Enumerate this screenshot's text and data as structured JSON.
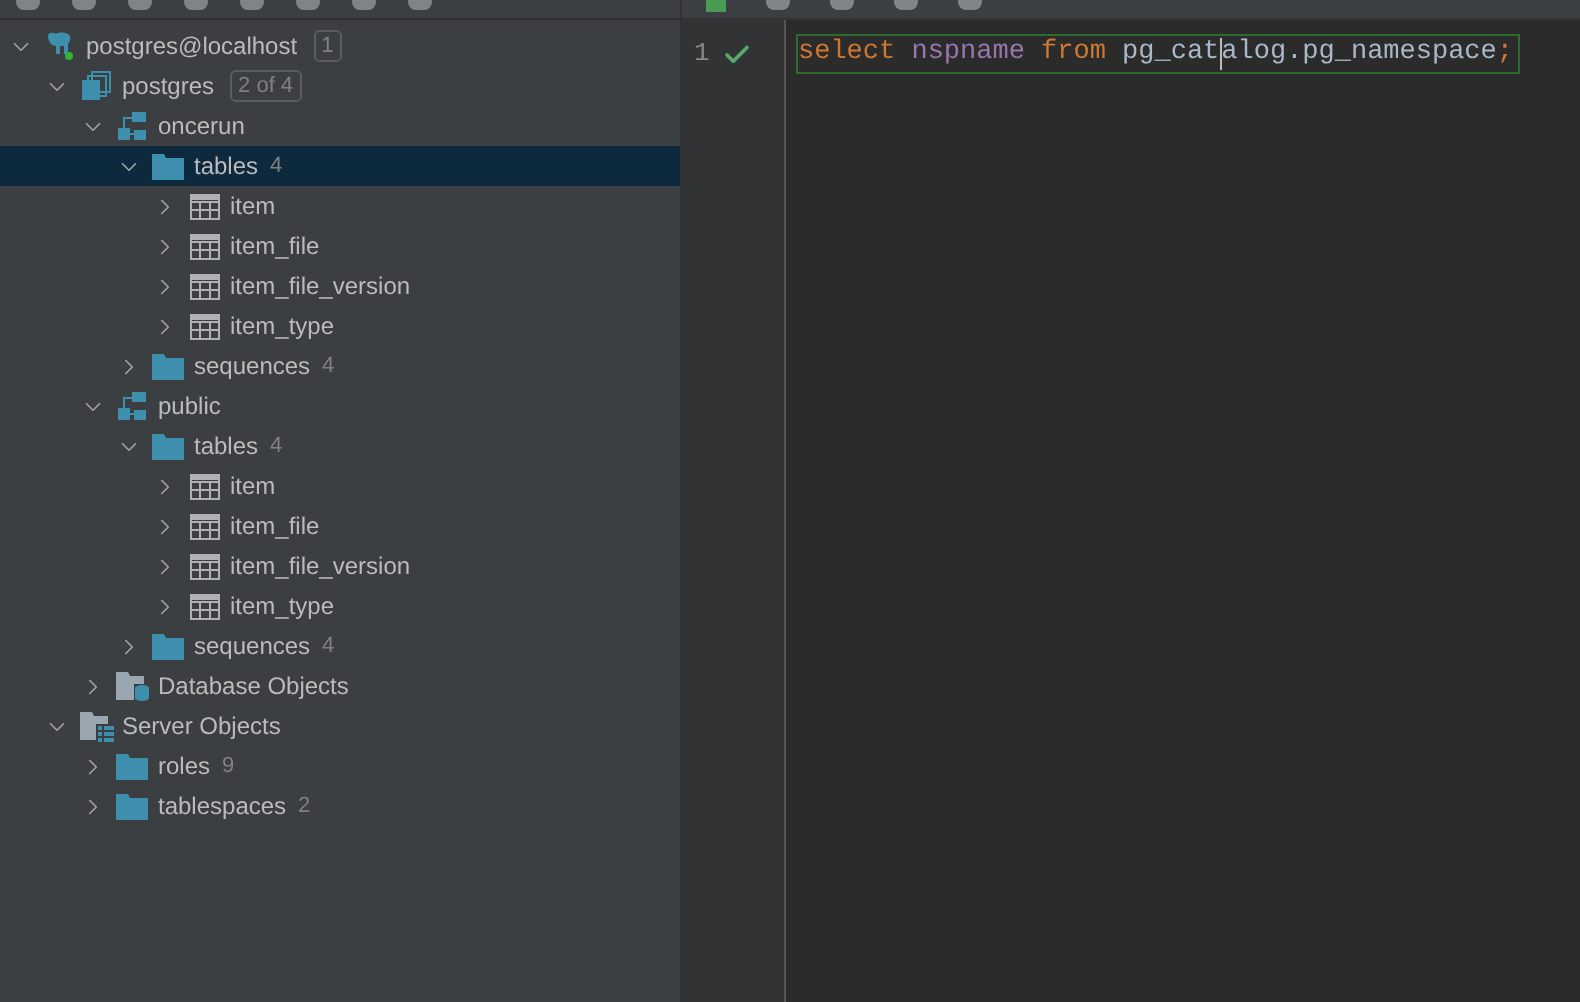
{
  "tree": [
    {
      "kind": "server",
      "label": "postgres@localhost",
      "badge": "1",
      "expanded": true,
      "selected": false,
      "children": [
        {
          "kind": "database",
          "label": "postgres",
          "badge": "2 of 4",
          "expanded": true,
          "selected": false,
          "children": [
            {
              "kind": "schema",
              "label": "oncerun",
              "expanded": true,
              "selected": false,
              "children": [
                {
                  "kind": "folder",
                  "label": "tables",
                  "count": "4",
                  "expanded": true,
                  "selected": true,
                  "children": [
                    {
                      "kind": "table",
                      "label": "item",
                      "expanded": false,
                      "selected": false
                    },
                    {
                      "kind": "table",
                      "label": "item_file",
                      "expanded": false,
                      "selected": false
                    },
                    {
                      "kind": "table",
                      "label": "item_file_version",
                      "expanded": false,
                      "selected": false
                    },
                    {
                      "kind": "table",
                      "label": "item_type",
                      "expanded": false,
                      "selected": false
                    }
                  ]
                },
                {
                  "kind": "folder",
                  "label": "sequences",
                  "count": "4",
                  "expanded": false,
                  "selected": false
                }
              ]
            },
            {
              "kind": "schema",
              "label": "public",
              "expanded": true,
              "selected": false,
              "children": [
                {
                  "kind": "folder",
                  "label": "tables",
                  "count": "4",
                  "expanded": true,
                  "selected": false,
                  "children": [
                    {
                      "kind": "table",
                      "label": "item",
                      "expanded": false,
                      "selected": false
                    },
                    {
                      "kind": "table",
                      "label": "item_file",
                      "expanded": false,
                      "selected": false
                    },
                    {
                      "kind": "table",
                      "label": "item_file_version",
                      "expanded": false,
                      "selected": false
                    },
                    {
                      "kind": "table",
                      "label": "item_type",
                      "expanded": false,
                      "selected": false
                    }
                  ]
                },
                {
                  "kind": "folder",
                  "label": "sequences",
                  "count": "4",
                  "expanded": false,
                  "selected": false
                }
              ]
            },
            {
              "kind": "db-objects",
              "label": "Database Objects",
              "expanded": false,
              "selected": false
            }
          ]
        },
        {
          "kind": "server-objects",
          "label": "Server Objects",
          "expanded": true,
          "selected": false,
          "children": [
            {
              "kind": "folder",
              "label": "roles",
              "count": "9",
              "expanded": false,
              "selected": false
            },
            {
              "kind": "folder",
              "label": "tablespaces",
              "count": "2",
              "expanded": false,
              "selected": false
            }
          ]
        }
      ]
    }
  ],
  "editor": {
    "lines": [
      {
        "number": "1",
        "passed": true,
        "tokens": [
          {
            "text": "select ",
            "kind": "keyword"
          },
          {
            "text": "nspname ",
            "kind": "column"
          },
          {
            "text": "from ",
            "kind": "keyword"
          },
          {
            "text": "pg_cat",
            "kind": "plain",
            "caret": true
          },
          {
            "text": "alog",
            "kind": "plain"
          },
          {
            "text": ".pg_namespace",
            "kind": "plain"
          },
          {
            "text": ";",
            "kind": "keyword"
          }
        ]
      }
    ]
  }
}
